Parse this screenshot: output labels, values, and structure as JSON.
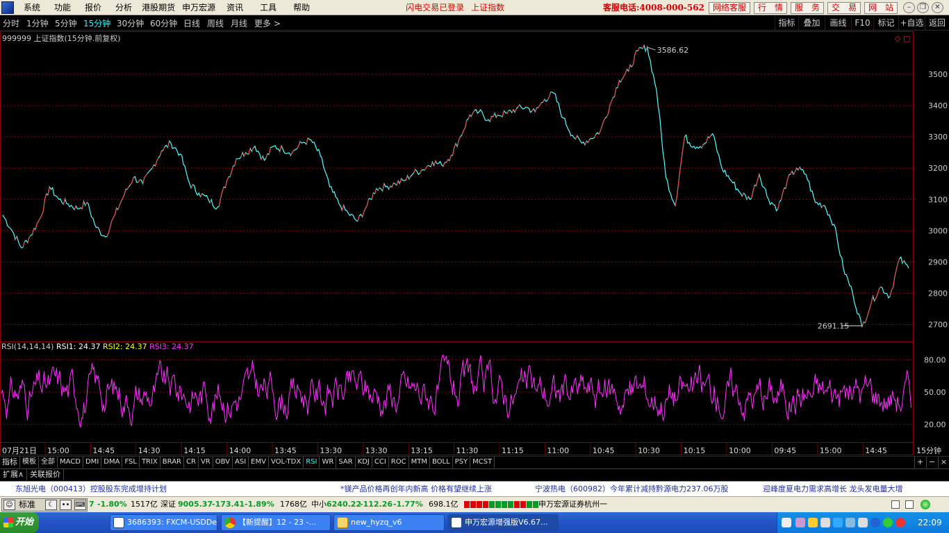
{
  "menubar": {
    "items": [
      "系统",
      "功能",
      "报价",
      "分析",
      "港股期货",
      "申万宏源",
      "资讯",
      "工具",
      "帮助"
    ],
    "flash_login": "闪电交易已登录",
    "current_index": "上证指数",
    "hotline": "客服电话:4008-000-562",
    "services": [
      "网络客服",
      "行　情",
      "服　务",
      "交　易",
      "网　站"
    ]
  },
  "periodbar": {
    "periods": [
      "分时",
      "1分钟",
      "5分钟",
      "15分钟",
      "30分钟",
      "60分钟",
      "日线",
      "周线",
      "月线",
      "更多 >"
    ],
    "active": "15分钟",
    "tools": [
      "指标",
      "叠加",
      "画线",
      "F10",
      "标记",
      "+自选",
      "返回"
    ]
  },
  "chart_title": "999999 上证指数(15分钟.前复权)",
  "rsi_title": {
    "name": "RSI(14,14,14)",
    "rsi1": "RSI1: 24.37",
    "rsi2": "RSI2: 24.37",
    "rsi3": "RSI3: 24.37"
  },
  "period_label": "15分钟",
  "colors": {
    "up": "#ff3333",
    "down": "#54ffff",
    "rsi": "#ff33ff",
    "grid": "#8b0000"
  },
  "chart_data": {
    "type": "line",
    "series_name": "上证指数",
    "ylim": [
      2650,
      3620
    ],
    "y_ticks": [
      2700,
      2800,
      2900,
      3000,
      3100,
      3200,
      3300,
      3400,
      3500
    ],
    "high_label": "3586.62",
    "low_label": "2691.15",
    "price_points": [
      3050,
      3000,
      2945,
      2985,
      3040,
      3140,
      3100,
      3085,
      3070,
      3090,
      3010,
      2980,
      3050,
      3115,
      3170,
      3150,
      3200,
      3255,
      3280,
      3245,
      3150,
      3120,
      3100,
      3075,
      3160,
      3230,
      3250,
      3270,
      3225,
      3270,
      3260,
      3250,
      3280,
      3290,
      3240,
      3140,
      3085,
      3055,
      3030,
      3080,
      3135,
      3140,
      3150,
      3160,
      3185,
      3195,
      3220,
      3210,
      3240,
      3300,
      3370,
      3380,
      3355,
      3370,
      3375,
      3390,
      3395,
      3380,
      3420,
      3440,
      3360,
      3305,
      3280,
      3295,
      3320,
      3400,
      3480,
      3510,
      3575,
      3586.62,
      3450,
      3170,
      3080,
      3300,
      3270,
      3275,
      3310,
      3200,
      3160,
      3120,
      3100,
      3180,
      3100,
      3070,
      3160,
      3200,
      3180,
      3090,
      3080,
      3020,
      2880,
      2800,
      2691.15,
      2770,
      2820,
      2790,
      2910,
      2880
    ],
    "x_labels": [
      "07月21日",
      "15:00",
      "14:45",
      "14:30",
      "14:15",
      "14:00",
      "13:45",
      "13:30",
      "13:30",
      "13:15",
      "11:30",
      "11:15",
      "11:00",
      "10:45",
      "10:30",
      "10:15",
      "10:00",
      "09:45",
      "15:00",
      "14:45"
    ],
    "rsi_ticks": [
      20.0,
      50.0,
      80.0
    ],
    "rsi_ylim": [
      5,
      95
    ]
  },
  "indicators": [
    "指标",
    "模板",
    "全部",
    "MACD",
    "DMI",
    "DMA",
    "FSL",
    "TRIX",
    "BRAR",
    "CR",
    "VR",
    "OBV",
    "ASI",
    "EMV",
    "VOL-TDX",
    "RSI",
    "WR",
    "SAR",
    "KDJ",
    "CCI",
    "ROC",
    "MTM",
    "BOLL",
    "PSY",
    "MCST"
  ],
  "active_indicator": "RSI",
  "zoom": [
    "+",
    "−",
    "×"
  ],
  "ext_tabs": [
    "扩展∧",
    "关联报价"
  ],
  "ticker": [
    "东旭光电（000413）控股股东完成增持计划",
    "*镁产品价格再创年内新高 价格有望继续上涨",
    "宁波热电（600982）今年累计减持黔源电力237.06万股",
    "迎峰度夏电力需求高增长 龙头发电量大增"
  ],
  "statusbar": {
    "std_label": "标准",
    "sh_tail": "7",
    "sh_pct": "-1.80%",
    "sh_amount": "1517亿",
    "sz_name": "深证",
    "sz_value": "9005.37",
    "sz_change": "-173.41",
    "sz_pct": "-1.89%",
    "sz_amount": "1768亿",
    "zx_name": "中小",
    "zx_value": "6240.22",
    "zx_change": "-112.26",
    "zx_pct": "-1.77%",
    "zx_amount": "698.1亿",
    "broker": "申万宏源证券杭州一"
  },
  "taskbar": {
    "start": "开始",
    "tasks": [
      "3686393: FXCM-USDDe...",
      "【新提醒】12 - 23 -...",
      "new_hyzq_v6",
      "申万宏源增强版V6.67..."
    ],
    "clock": "22:09"
  }
}
